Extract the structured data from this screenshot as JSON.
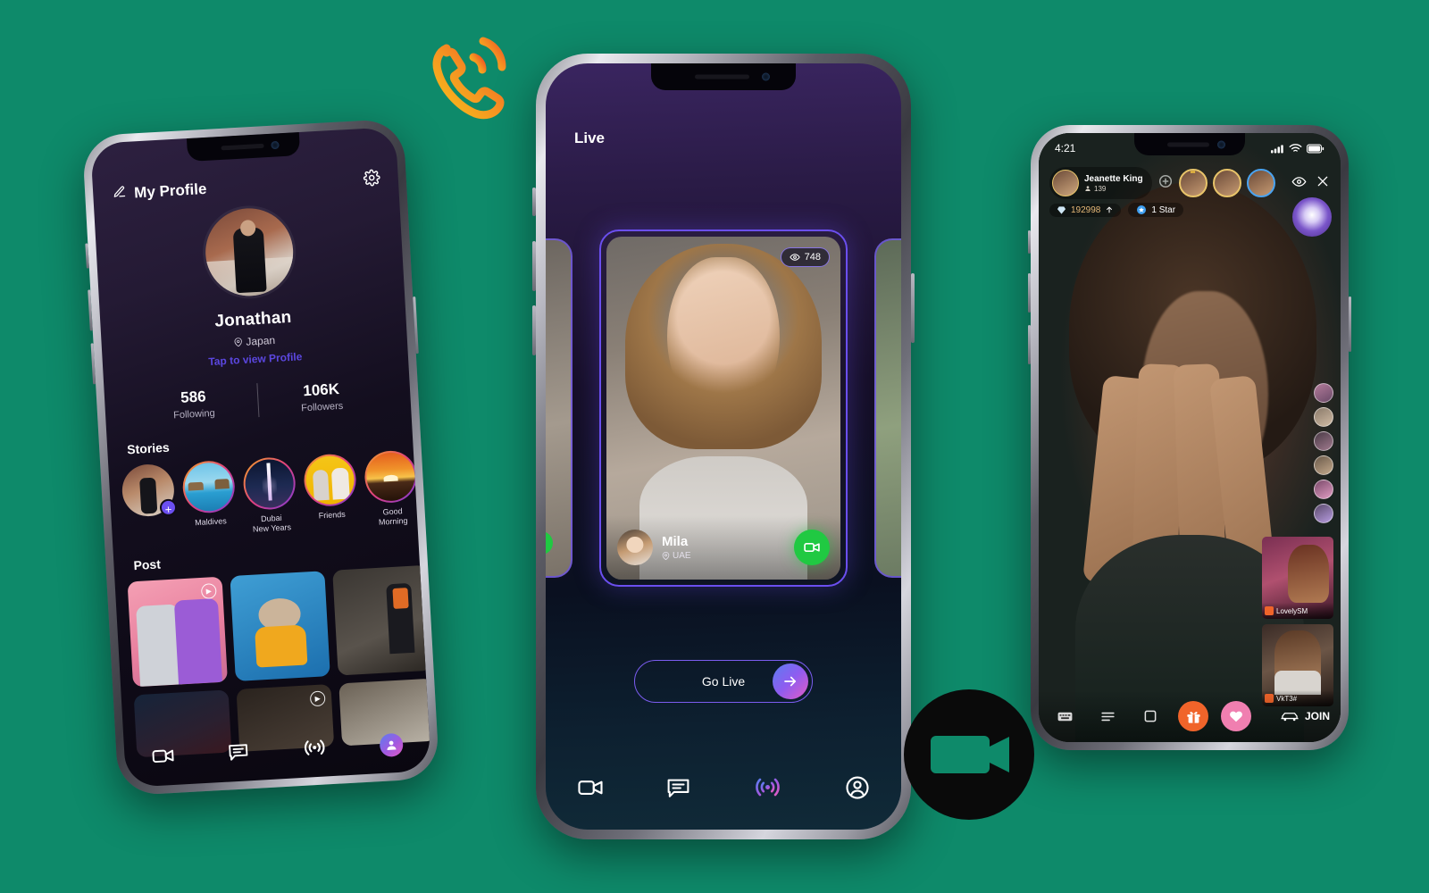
{
  "theme": {
    "background": "#0e8a6a",
    "accent_purple": "#6b4ff0",
    "link_purple": "#5b47e0",
    "green_call": "#20c942",
    "orange_gift": "#f0642a",
    "pink_heart": "#f07fb0"
  },
  "decorations": {
    "call_icon": "phone-call-icon",
    "camera_blob": "video-camera-icon"
  },
  "phone_profile": {
    "header": {
      "title": "My Profile",
      "edit_icon": "pencil-icon",
      "settings_icon": "gear-icon"
    },
    "profile": {
      "avatar": "user-avatar",
      "name": "Jonathan",
      "location": "Japan",
      "location_icon": "map-pin-icon",
      "link": "Tap to view Profile"
    },
    "stats": [
      {
        "value": "586",
        "label": "Following"
      },
      {
        "value": "106K",
        "label": "Followers"
      }
    ],
    "stories_title": "Stories",
    "stories": [
      {
        "label": "",
        "add": "+"
      },
      {
        "label": "Maldives"
      },
      {
        "label": "Dubai\nNew Years"
      },
      {
        "label": "Friends"
      },
      {
        "label": "Good\nMorning"
      }
    ],
    "posts_title": "Post",
    "posts": [
      {
        "name": "post-friends-selfie",
        "has_play": true
      },
      {
        "name": "post-dog",
        "has_play": false
      },
      {
        "name": "post-man-desk",
        "has_play": false
      },
      {
        "name": "post-city-night",
        "has_play": false
      },
      {
        "name": "post-man-suit",
        "has_play": true
      },
      {
        "name": "post-car",
        "has_play": false
      }
    ],
    "nav": [
      {
        "icon": "video-camera-icon",
        "active": false
      },
      {
        "icon": "chat-bubble-icon",
        "active": false
      },
      {
        "icon": "live-broadcast-icon",
        "active": false
      },
      {
        "icon": "profile-avatar-icon",
        "active": true
      }
    ]
  },
  "phone_live": {
    "title": "Live",
    "card": {
      "viewers": "748",
      "viewers_icon": "eye-icon",
      "name": "Mila",
      "location": "UAE",
      "location_icon": "map-pin-icon",
      "call_button_icon": "video-call-icon"
    },
    "go_live": {
      "label": "Go Live",
      "arrow": "arrow-right-icon"
    },
    "nav": [
      {
        "icon": "video-camera-icon",
        "active": false
      },
      {
        "icon": "chat-bubble-icon",
        "active": false
      },
      {
        "icon": "live-broadcast-icon",
        "active": true
      },
      {
        "icon": "profile-avatar-icon",
        "active": false
      }
    ]
  },
  "phone_stream": {
    "status_bar": {
      "time": "4:21",
      "signal_icon": "cellular-icon",
      "wifi_icon": "wifi-icon",
      "battery_icon": "battery-icon"
    },
    "host": {
      "name": "Jeanette King",
      "viewers": "139",
      "viewers_icon": "viewers-icon"
    },
    "top_avatars": [
      {
        "name": "top-ranked-viewer-1",
        "crown": true
      },
      {
        "name": "top-ranked-viewer-2",
        "crown": false
      },
      {
        "name": "top-ranked-viewer-3",
        "crown": false
      }
    ],
    "eye_icon": "eye-icon",
    "close_icon": "close-icon",
    "coins": {
      "value": "192998",
      "icon": "diamond-icon",
      "up_icon": "arrow-up-icon"
    },
    "star": {
      "label": "1 Star",
      "icon": "star-badge-icon"
    },
    "gift_badge": "gift-wheel-icon",
    "side_thumbnails": [
      {
        "label": "LovelySM"
      },
      {
        "label": "VkT3#"
      }
    ],
    "toolbar": [
      {
        "icon": "keyboard-icon",
        "name": "keyboard-button"
      },
      {
        "icon": "list-icon",
        "name": "list-button"
      },
      {
        "icon": "frame-icon",
        "name": "frame-button"
      },
      {
        "icon": "gift-icon",
        "name": "gift-button"
      },
      {
        "icon": "heart-icon",
        "name": "heart-button"
      }
    ],
    "join": {
      "label": "JOIN",
      "icon": "car-icon"
    }
  }
}
